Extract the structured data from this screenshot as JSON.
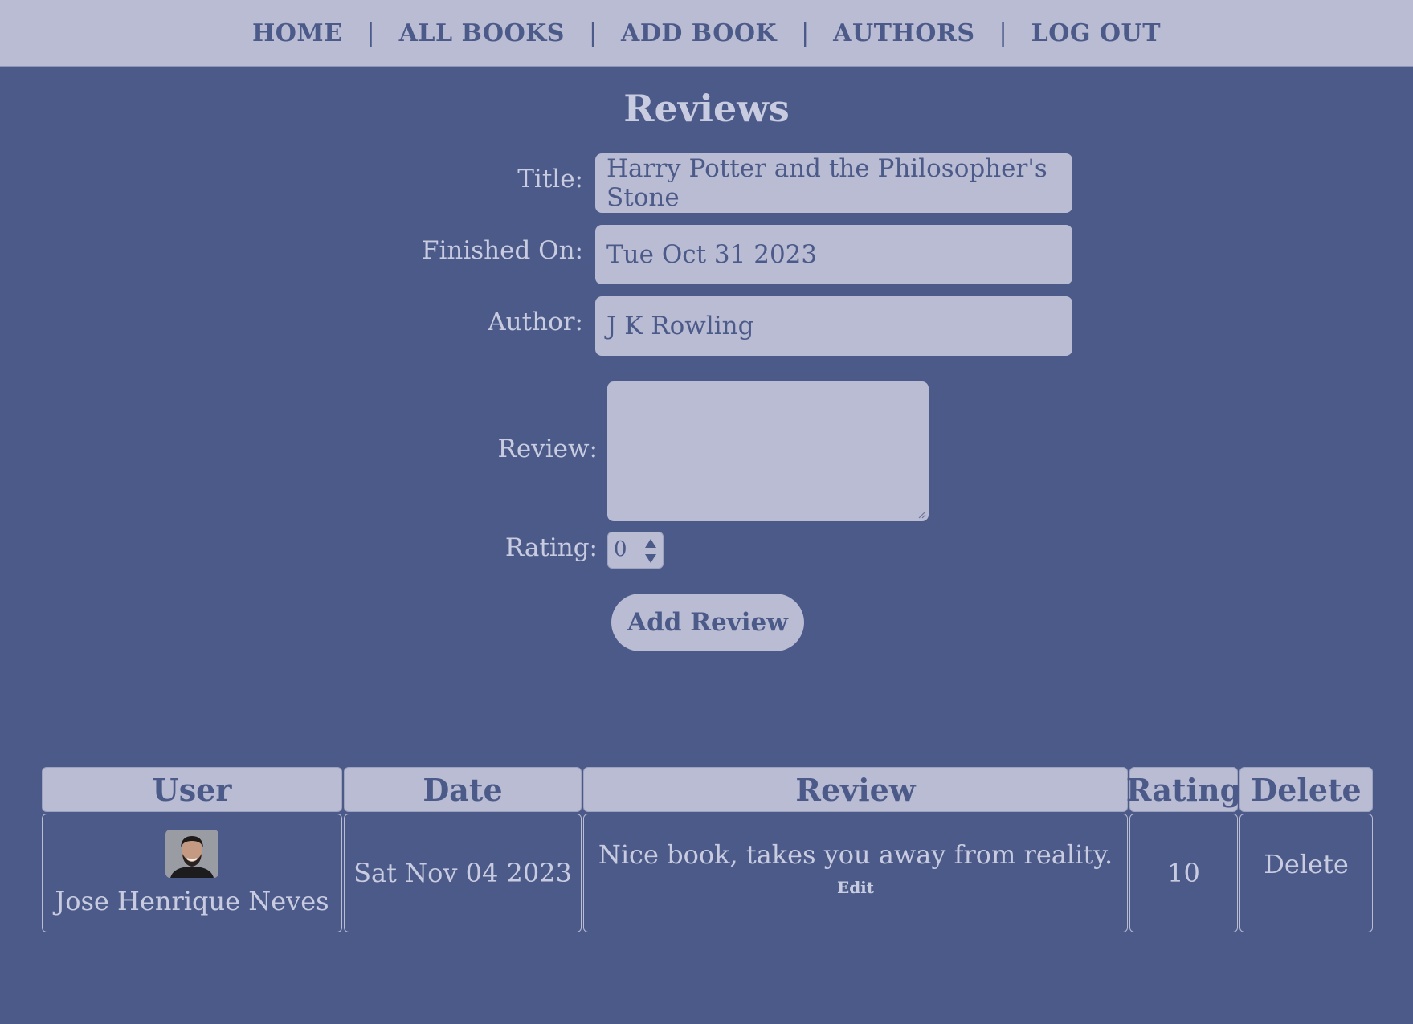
{
  "nav": {
    "items": [
      "HOME",
      "ALL BOOKS",
      "ADD BOOK",
      "AUTHORS",
      "LOG OUT"
    ],
    "separator": "|"
  },
  "page": {
    "title": "Reviews"
  },
  "form": {
    "title_label": "Title:",
    "title_value": "Harry Potter and the Philosopher's Stone",
    "finished_label": "Finished On:",
    "finished_value": "Tue Oct 31 2023",
    "author_label": "Author:",
    "author_value": "J K Rowling",
    "review_label": "Review:",
    "review_value": "",
    "rating_label": "Rating:",
    "rating_value": "0",
    "submit_label": "Add Review"
  },
  "table": {
    "headers": [
      "User",
      "Date",
      "Review",
      "Rating",
      "Delete"
    ],
    "rows": [
      {
        "user": "Jose Henrique Neves",
        "date": "Sat Nov 04 2023",
        "review": "Nice book, takes you away from reality.",
        "edit_label": "Edit",
        "rating": "10",
        "delete_label": "Delete"
      }
    ]
  },
  "colors": {
    "background": "#4b5a89",
    "panel": "#b9bcd3",
    "text_light": "#c9cce0",
    "text_dark": "#4b5a89"
  }
}
